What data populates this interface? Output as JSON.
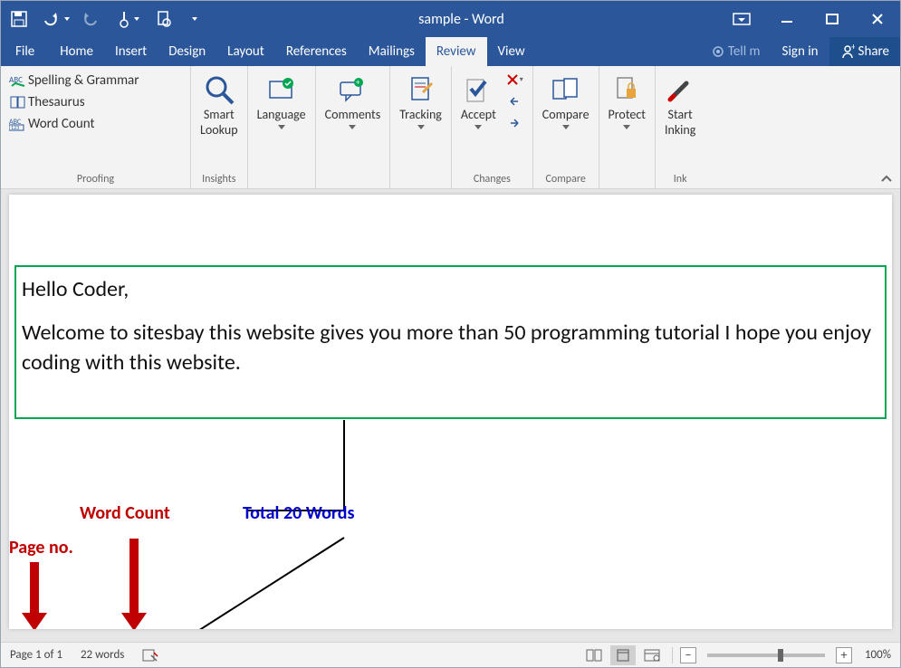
{
  "titlebar": {
    "title": "sample - Word"
  },
  "tabs": {
    "file": "File",
    "items": [
      "Home",
      "Insert",
      "Design",
      "Layout",
      "References",
      "Mailings",
      "Review",
      "View"
    ],
    "active": "Review",
    "tell_me": "Tell m",
    "sign_in": "Sign in",
    "share": "Share"
  },
  "ribbon": {
    "proofing": {
      "spelling": "Spelling & Grammar",
      "thesaurus": "Thesaurus",
      "wordcount": "Word Count",
      "group": "Proofing"
    },
    "insights": {
      "smart_lookup": "Smart\nLookup",
      "group": "Insights"
    },
    "language": {
      "label": "Language",
      "group": ""
    },
    "comments": {
      "label": "Comments",
      "group": ""
    },
    "tracking": {
      "label": "Tracking",
      "group": ""
    },
    "changes": {
      "accept": "Accept",
      "group": "Changes"
    },
    "compare": {
      "label": "Compare",
      "group": "Compare"
    },
    "protect": {
      "label": "Protect",
      "group": ""
    },
    "ink": {
      "label": "Start\nInking",
      "group": "Ink"
    }
  },
  "document": {
    "greeting": "Hello Coder,",
    "body": "Welcome to sitesbay this website gives you more than 50 programming tutorial I hope you enjoy coding with this website."
  },
  "annotations": {
    "word_count": "Word Count",
    "total_words": "Total 20 Words",
    "page_no": "Page no."
  },
  "statusbar": {
    "page": "Page 1 of 1",
    "words": "22 words",
    "zoom": "100%"
  }
}
